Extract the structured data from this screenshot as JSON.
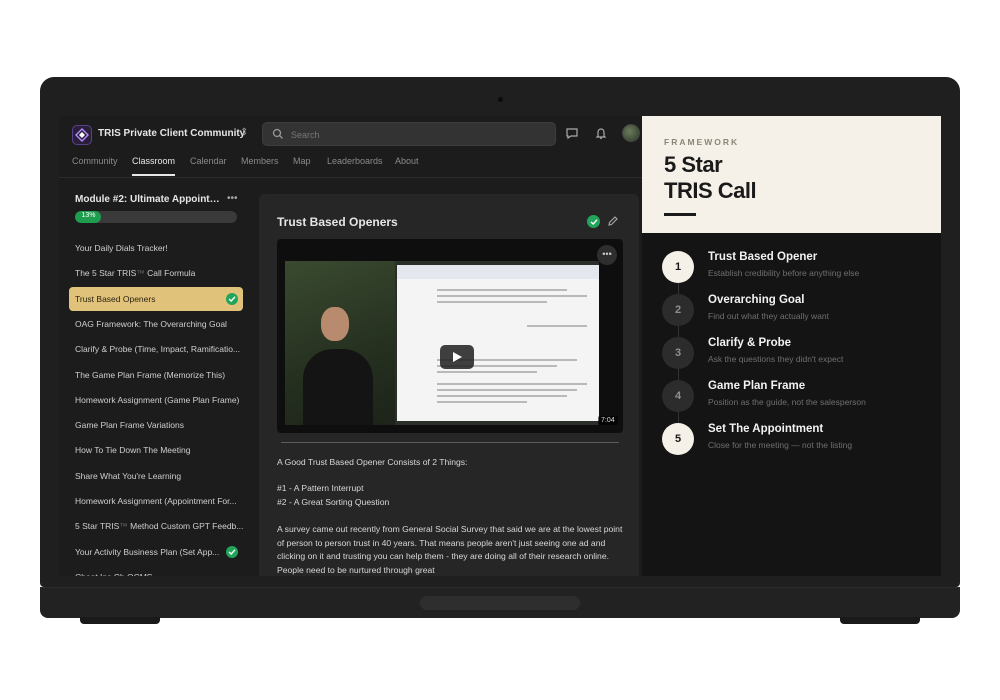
{
  "app": {
    "community_name": "TRIS Private Client Community",
    "search_placeholder": "Search"
  },
  "nav": {
    "items": [
      "Community",
      "Classroom",
      "Calendar",
      "Members",
      "Map",
      "Leaderboards",
      "About"
    ],
    "active": "Classroom"
  },
  "module": {
    "title": "Module #2: Ultimate Appointme...",
    "progress_label": "13%",
    "progress": 0.13
  },
  "lessons": [
    {
      "label": "Your Daily Dials Tracker!",
      "done": false
    },
    {
      "label": "The 5 Star TRIS",
      "suffix": "Call Formula",
      "dim": "™",
      "done": false
    },
    {
      "label": "Trust Based Openers",
      "done": true,
      "active": true
    },
    {
      "label": "OAG Framework: The Overarching Goal",
      "done": false
    },
    {
      "label": "Clarify & Probe (Time, Impact, Ramificatio...",
      "done": false
    },
    {
      "label": "The Game Plan Frame (Memorize This)",
      "done": false
    },
    {
      "label": "Homework Assignment (Game Plan Frame)",
      "done": false
    },
    {
      "label": "Game Plan Frame Variations",
      "done": false
    },
    {
      "label": "How To Tie Down The Meeting",
      "done": false
    },
    {
      "label": "Share What You're Learning",
      "done": false
    },
    {
      "label": "Homework Assignment (Appointment For...",
      "done": false
    },
    {
      "label": "5 Star TRIS",
      "suffix": "Method Custom GPT Feedb...",
      "dim": "™",
      "done": false
    },
    {
      "label": "Your Activity Business Plan (Set App...",
      "done": true
    },
    {
      "label": "Cheat Ins Ch OCMS",
      "done": false
    }
  ],
  "lesson_content": {
    "heading": "Trust Based Openers",
    "video_duration": "7:04",
    "video_menu": "•••",
    "intro": "A Good Trust Based Opener Consists of 2 Things:",
    "point1": "#1 - A Pattern Interrupt",
    "point2": "#2 - A Great Sorting Question",
    "paragraph": "A survey came out recently from General Social Survey that said we are at the lowest point of person to person trust in 40 years. That means people aren't just seeing one ad and clicking on it and trusting you can help them - they are doing all of their research online. People need to be nurtured through great"
  },
  "framework": {
    "eyebrow": "FRAMEWORK",
    "title_line1": "5 Star",
    "title_line2": "TRIS Call",
    "steps": [
      {
        "num": "1",
        "title": "Trust Based Opener",
        "desc": "Establish credibility before anything else",
        "highlight": true
      },
      {
        "num": "2",
        "title": "Overarching Goal",
        "desc": "Find out what they actually want",
        "highlight": false
      },
      {
        "num": "3",
        "title": "Clarify & Probe",
        "desc": "Ask the questions they didn't expect",
        "highlight": false
      },
      {
        "num": "4",
        "title": "Game Plan Frame",
        "desc": "Position as the guide, not the salesperson",
        "highlight": false
      },
      {
        "num": "5",
        "title": "Set The Appointment",
        "desc": "Close for the meeting — not the listing",
        "highlight": true
      }
    ]
  },
  "colors": {
    "accent_gold": "#e1c27a",
    "success_green": "#22a55b",
    "cream": "#f5f1e8"
  }
}
